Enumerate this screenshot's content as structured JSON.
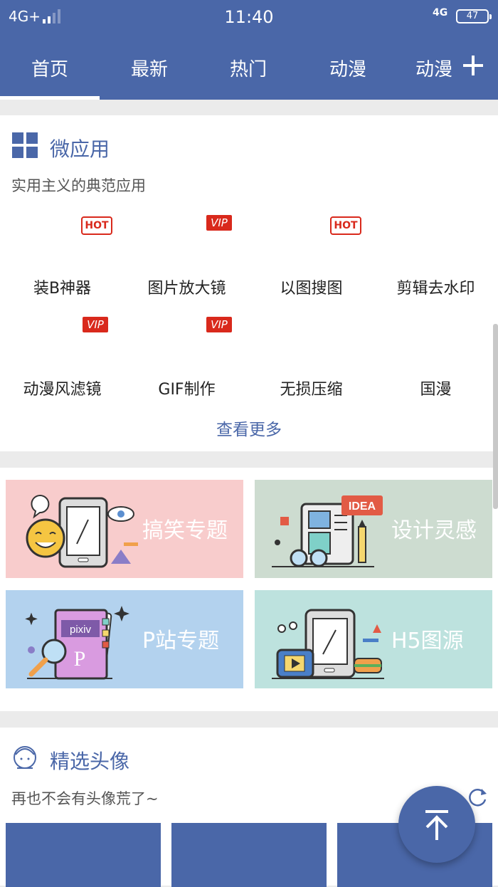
{
  "status_bar": {
    "network_left": "4G+",
    "time": "11:40",
    "network_right": "4G",
    "battery": "47"
  },
  "tabs": [
    {
      "label": "首页"
    },
    {
      "label": "最新"
    },
    {
      "label": "热门"
    },
    {
      "label": "动漫"
    },
    {
      "label": "动漫"
    }
  ],
  "micro_apps": {
    "title": "微应用",
    "subtitle": "实用主义的典范应用",
    "more_label": "查看更多",
    "items": [
      {
        "label": "装B神器",
        "badge": "HOT"
      },
      {
        "label": "图片放大镜",
        "badge": "VIP"
      },
      {
        "label": "以图搜图",
        "badge": "HOT"
      },
      {
        "label": "剪辑去水印",
        "badge": ""
      },
      {
        "label": "动漫风滤镜",
        "badge": "VIP"
      },
      {
        "label": "GIF制作",
        "badge": "VIP"
      },
      {
        "label": "无损压缩",
        "badge": ""
      },
      {
        "label": "国漫",
        "badge": ""
      }
    ]
  },
  "topics": [
    {
      "label": "搞笑专题",
      "color": "#f8cccc"
    },
    {
      "label": "设计灵感",
      "color": "#cddcd0"
    },
    {
      "label": "P站专题",
      "color": "#b3d2ee"
    },
    {
      "label": "H5图源",
      "color": "#bde2de"
    }
  ],
  "topic_art": {
    "idea": "IDEA",
    "pixiv": "pixiv"
  },
  "avatars": {
    "title": "精选头像",
    "subtitle": "再也不会有头像荒了~"
  },
  "colors": {
    "brand": "#4a67a8",
    "badge_red": "#d9291c"
  }
}
